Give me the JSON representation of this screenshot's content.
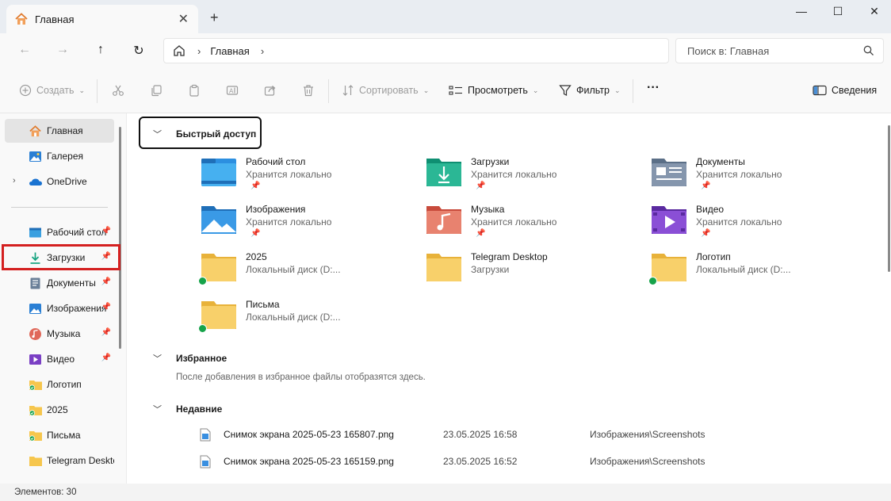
{
  "window": {
    "tab_title": "Главная",
    "tab_close": "✕",
    "new_tab": "+",
    "minimize": "—",
    "maximize": "☐",
    "close": "✕"
  },
  "nav": {
    "back": "←",
    "forward": "→",
    "up": "↑",
    "refresh": "↻",
    "breadcrumb": "Главная",
    "search_placeholder": "Поиск в: Главная"
  },
  "toolbar": {
    "create": "Создать",
    "sort": "Сортировать",
    "view": "Просмотреть",
    "filter": "Фильтр",
    "more": "···",
    "details": "Сведения"
  },
  "sidebar": {
    "items": [
      {
        "label": "Главная",
        "icon": "home-icon",
        "active": true
      },
      {
        "label": "Галерея",
        "icon": "gallery-icon"
      },
      {
        "label": "OneDrive",
        "icon": "onedrive-icon",
        "expandable": true
      },
      {
        "label": "Рабочий стол",
        "icon": "desktop-icon",
        "pinned": true
      },
      {
        "label": "Загрузки",
        "icon": "downloads-icon",
        "pinned": true
      },
      {
        "label": "Документы",
        "icon": "documents-icon",
        "pinned": true
      },
      {
        "label": "Изображения",
        "icon": "pictures-icon",
        "pinned": true
      },
      {
        "label": "Музыка",
        "icon": "music-icon",
        "pinned": true
      },
      {
        "label": "Видео",
        "icon": "video-icon",
        "pinned": true
      },
      {
        "label": "Логотип",
        "icon": "folder-icon",
        "synced": true
      },
      {
        "label": "2025",
        "icon": "folder-icon",
        "synced": true
      },
      {
        "label": "Письма",
        "icon": "folder-icon",
        "synced": true
      },
      {
        "label": "Telegram Desktop",
        "icon": "folder-icon"
      }
    ]
  },
  "quick_access": {
    "title": "Быстрый доступ",
    "items": [
      {
        "name": "Рабочий стол",
        "sub": "Хранится локально",
        "icon": "desktop-folder-icon",
        "pinned": true
      },
      {
        "name": "Загрузки",
        "sub": "Хранится локально",
        "icon": "downloads-folder-icon",
        "pinned": true
      },
      {
        "name": "Документы",
        "sub": "Хранится локально",
        "icon": "documents-folder-icon",
        "pinned": true
      },
      {
        "name": "Изображения",
        "sub": "Хранится локально",
        "icon": "pictures-folder-icon",
        "pinned": true
      },
      {
        "name": "Музыка",
        "sub": "Хранится локально",
        "icon": "music-folder-icon",
        "pinned": true
      },
      {
        "name": "Видео",
        "sub": "Хранится локально",
        "icon": "video-folder-icon",
        "pinned": true
      },
      {
        "name": "2025",
        "sub": "Локальный диск (D:...",
        "icon": "folder-icon",
        "synced": true
      },
      {
        "name": "Telegram Desktop",
        "sub": "Загрузки",
        "icon": "folder-icon"
      },
      {
        "name": "Логотип",
        "sub": "Локальный диск (D:...",
        "icon": "folder-icon",
        "synced": true
      },
      {
        "name": "Письма",
        "sub": "Локальный диск (D:...",
        "icon": "folder-icon",
        "synced": true
      }
    ]
  },
  "favorites": {
    "title": "Избранное",
    "empty_text": "После добавления в избранное файлы отобразятся здесь."
  },
  "recent": {
    "title": "Недавние",
    "rows": [
      {
        "name": "Снимок экрана 2025-05-23 165807.png",
        "date": "23.05.2025 16:58",
        "path": "Изображения\\Screenshots"
      },
      {
        "name": "Снимок экрана 2025-05-23 165159.png",
        "date": "23.05.2025 16:52",
        "path": "Изображения\\Screenshots"
      }
    ]
  },
  "status": {
    "count": "Элементов: 30"
  },
  "colors": {
    "highlight": "#d42020",
    "folder": "#f6c64d",
    "synced": "#16a34a"
  }
}
